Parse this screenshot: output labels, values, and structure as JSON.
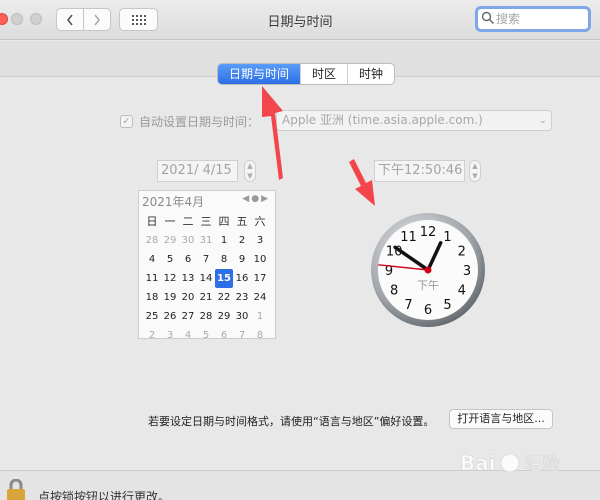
{
  "window": {
    "title": "日期与时间"
  },
  "search": {
    "placeholder": "搜索"
  },
  "tabs": [
    {
      "label": "日期与时间",
      "active": true
    },
    {
      "label": "时区",
      "active": false
    },
    {
      "label": "时钟",
      "active": false
    }
  ],
  "auto_set": {
    "label": "自动设置日期与时间：",
    "checked": true,
    "server": "Apple 亚洲 (time.asia.apple.com.)"
  },
  "date_field": {
    "value": "2021/  4/15"
  },
  "time_field": {
    "value": "下午12:50:46"
  },
  "calendar": {
    "header": "2021年4月",
    "weekdays": [
      "日",
      "一",
      "二",
      "三",
      "四",
      "五",
      "六"
    ],
    "days": [
      [
        "28",
        "29",
        "30",
        "31",
        "1",
        "2",
        "3"
      ],
      [
        "4",
        "5",
        "6",
        "7",
        "8",
        "9",
        "10"
      ],
      [
        "11",
        "12",
        "13",
        "14",
        "15",
        "16",
        "17"
      ],
      [
        "18",
        "19",
        "20",
        "21",
        "22",
        "23",
        "24"
      ],
      [
        "25",
        "26",
        "27",
        "28",
        "29",
        "30",
        "1"
      ],
      [
        "2",
        "3",
        "4",
        "5",
        "6",
        "7",
        "8"
      ]
    ],
    "selected_day": "15"
  },
  "clock": {
    "numbers": [
      "12",
      "1",
      "2",
      "3",
      "4",
      "5",
      "6",
      "7",
      "8",
      "9",
      "10",
      "11"
    ],
    "period_label": "下午",
    "hour": 12,
    "minute": 50,
    "second": 46
  },
  "footer": {
    "format_note": "若要设定日期与时间格式，请使用“语言与地区”偏好设置。",
    "open_button": "打开语言与地区...",
    "lock_text": "点按锁按钮以进行更改。"
  },
  "watermark": {
    "text": "Bai 经验"
  },
  "colors": {
    "accent": "#2c6fe6",
    "arrow": "#f2454c",
    "second_hand": "#d0021b"
  }
}
